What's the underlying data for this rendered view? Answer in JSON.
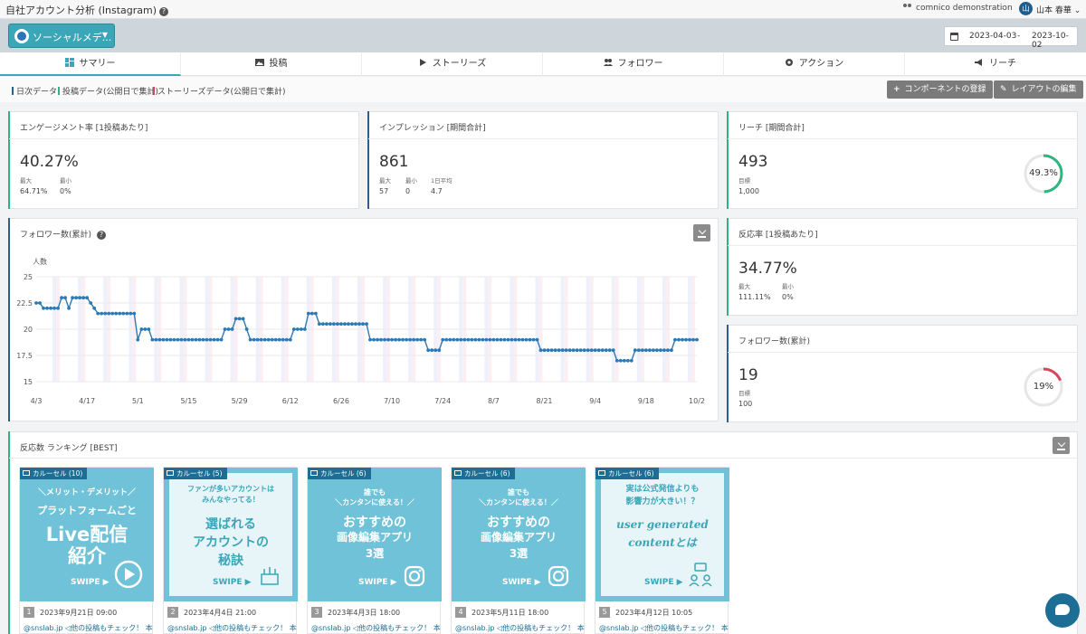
{
  "app": {
    "title": "自社アカウント分析 (Instagram)",
    "help": "?"
  },
  "header": {
    "organization": "comnico demonstration",
    "separator": "›",
    "avatar": "山",
    "user_name": "山本 春華 ⌄"
  },
  "toolbar": {
    "media_select": "ソーシャルメデ...",
    "date_from": "2023-04-03",
    "date_separator": "-",
    "date_to": "2023-10-02"
  },
  "tabs": [
    {
      "label": "サマリー",
      "icon": "grid-icon"
    },
    {
      "label": "投稿",
      "icon": "image-icon"
    },
    {
      "label": "ストーリーズ",
      "icon": "play-icon"
    },
    {
      "label": "フォロワー",
      "icon": "people-icon"
    },
    {
      "label": "アクション",
      "icon": "gear-icon"
    },
    {
      "label": "リーチ",
      "icon": "megaphone-icon"
    }
  ],
  "legend": [
    {
      "label": "日次データ",
      "color": "#2b5f8f"
    },
    {
      "label": "投稿データ(公開日で集計)",
      "color": "#2fb37f"
    },
    {
      "label": "ストーリーズデータ(公開日で集計)",
      "color": "#d6455c"
    }
  ],
  "buttons": {
    "add_component": "コンポーネントの登録",
    "edit_layout": "レイアウトの編集"
  },
  "cards": {
    "engagement": {
      "title": "エンゲージメント率 [1投稿あたり]",
      "value": "40.27%",
      "max_label": "最大",
      "max": "64.71%",
      "min_label": "最小",
      "min": "0%"
    },
    "impression": {
      "title": "インプレッション [期間合計]",
      "value": "861",
      "max_label": "最大",
      "max": "57",
      "min_label": "最小",
      "min": "0",
      "avg_label": "1日平均",
      "avg": "4.7"
    },
    "reach": {
      "title": "リーチ [期間合計]",
      "value": "493",
      "target_label": "目標",
      "target": "1,000",
      "ring": "49.3%",
      "ring_fraction": 0.493,
      "ring_color": "#2fb37f"
    },
    "response": {
      "title": "反応率 [1投稿あたり]",
      "value": "34.77%",
      "max_label": "最大",
      "max": "111.11%",
      "min_label": "最小",
      "min": "0%"
    },
    "followers": {
      "title": "フォロワー数(累計)",
      "value": "19",
      "target_label": "目標",
      "target": "100",
      "ring": "19%",
      "ring_fraction": 0.19,
      "ring_color": "#d6455c"
    }
  },
  "chart": {
    "title": "フォロワー数(累計)",
    "help": "?"
  },
  "chart_data": {
    "type": "line",
    "ylabel": "人数",
    "ylim": [
      15,
      25
    ],
    "yticks": [
      "25",
      "22.5",
      "20",
      "17.5",
      "15"
    ],
    "xticks": [
      "4/3",
      "4/17",
      "5/1",
      "5/15",
      "5/29",
      "6/12",
      "6/26",
      "7/10",
      "7/24",
      "8/7",
      "8/21",
      "9/4",
      "9/18",
      "10/2"
    ],
    "x_start": "2023-04-03",
    "x_end": "2023-10-02",
    "series": [
      {
        "color": "#2b79b5",
        "steps": [
          [
            "2023-04-03",
            22.5
          ],
          [
            "2023-04-05",
            22
          ],
          [
            "2023-04-10",
            23
          ],
          [
            "2023-04-12",
            22
          ],
          [
            "2023-04-13",
            23
          ],
          [
            "2023-04-18",
            22.5
          ],
          [
            "2023-04-19",
            22
          ],
          [
            "2023-04-20",
            21.5
          ],
          [
            "2023-05-01",
            19
          ],
          [
            "2023-05-02",
            20
          ],
          [
            "2023-05-05",
            19
          ],
          [
            "2023-05-25",
            20
          ],
          [
            "2023-05-28",
            21
          ],
          [
            "2023-05-31",
            20
          ],
          [
            "2023-06-01",
            19
          ],
          [
            "2023-06-13",
            20
          ],
          [
            "2023-06-17",
            21.5
          ],
          [
            "2023-06-20",
            20.5
          ],
          [
            "2023-07-04",
            19
          ],
          [
            "2023-07-20",
            18
          ],
          [
            "2023-07-24",
            19
          ],
          [
            "2023-08-20",
            18
          ],
          [
            "2023-09-10",
            17
          ],
          [
            "2023-09-15",
            18
          ],
          [
            "2023-09-26",
            19
          ],
          [
            "2023-10-02",
            19
          ]
        ]
      }
    ]
  },
  "ranking": {
    "title": "反応数 ランキング [BEST]",
    "posts": [
      {
        "rank": "1",
        "badge": "カルーセル (10)",
        "date": "2023年9月21日 09:00",
        "sub": "＼メリット・デメリット／",
        "sub2": "プラットフォームごと",
        "head": "Live配信",
        "head2": "紹介",
        "swipe": "SWIPE ▶",
        "caption": "@snslab.jp ◁他の投稿もチェック！ 本日",
        "style": "dark"
      },
      {
        "rank": "2",
        "badge": "カルーセル (5)",
        "date": "2023年4月4日 21:00",
        "sub": "ファンが多いアカウントは",
        "sub2": "みんなやってる！",
        "head": "選ばれる",
        "head2": "アカウントの",
        "head3": "秘訣",
        "swipe": "SWIPE ▶",
        "caption": "@snslab.jp ◁他の投稿もチェック！ 本日",
        "style": "light"
      },
      {
        "rank": "3",
        "badge": "カルーセル (6)",
        "date": "2023年4月3日 18:00",
        "sub": "誰でも",
        "sub2": "＼カンタンに使える！／",
        "head": "おすすめの",
        "head2": "画像編集アプリ",
        "head3": "3選",
        "swipe": "SWIPE ▶",
        "caption": "@snslab.jp ◁他の投稿もチェック！ 本日",
        "style": "dark"
      },
      {
        "rank": "4",
        "badge": "カルーセル (6)",
        "date": "2023年5月11日 18:00",
        "sub": "誰でも",
        "sub2": "＼カンタンに使える！／",
        "head": "おすすめの",
        "head2": "画像編集アプリ",
        "head3": "3選",
        "swipe": "SWIPE ▶",
        "caption": "@snslab.jp ◁他の投稿もチェック！ 本日",
        "style": "dark"
      },
      {
        "rank": "5",
        "badge": "カルーセル (6)",
        "date": "2023年4月12日 10:05",
        "sub": "実は公式発信よりも",
        "sub2": "影響力が大きい！？",
        "head": "user generated",
        "head2": "contentとは",
        "swipe": "SWIPE ▶",
        "caption": "@snslab.jp ◁他の投稿もチェック！ 本日",
        "style": "light"
      }
    ]
  }
}
